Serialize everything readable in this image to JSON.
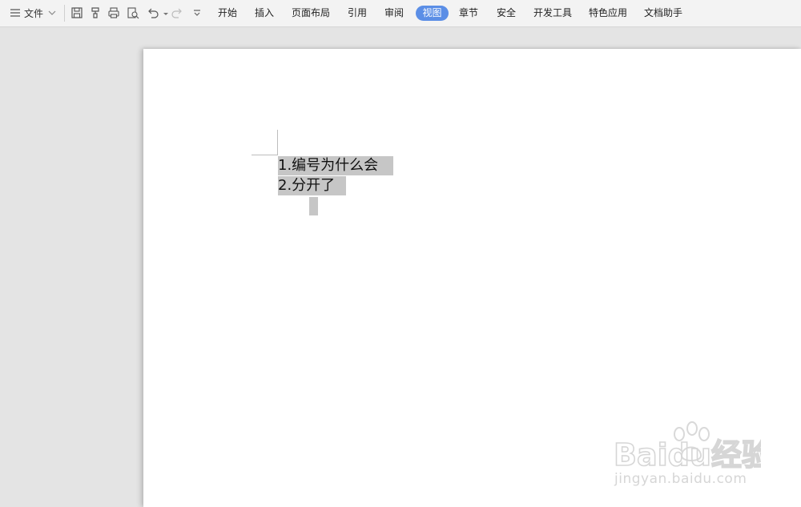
{
  "toolbar": {
    "file_menu": "文件",
    "icons": [
      "menu-icon",
      "chevron-down-icon",
      "save-icon",
      "format-painter-icon",
      "print-icon",
      "print-preview-icon",
      "undo-icon",
      "redo-icon",
      "more-icon"
    ],
    "tabs": [
      {
        "label": "开始",
        "active": false
      },
      {
        "label": "插入",
        "active": false
      },
      {
        "label": "页面布局",
        "active": false
      },
      {
        "label": "引用",
        "active": false
      },
      {
        "label": "审阅",
        "active": false
      },
      {
        "label": "视图",
        "active": true
      },
      {
        "label": "章节",
        "active": false
      },
      {
        "label": "安全",
        "active": false
      },
      {
        "label": "开发工具",
        "active": false
      },
      {
        "label": "特色应用",
        "active": false
      },
      {
        "label": "文档助手",
        "active": false
      }
    ],
    "active_tab_color": "#5b8ee6"
  },
  "document": {
    "lines": [
      "1.编号为什么会",
      "2.分开了"
    ],
    "selection_color": "#c6c6c6"
  },
  "watermark": {
    "brand": "Baidu经验",
    "url": "jingyan.baidu.com"
  }
}
